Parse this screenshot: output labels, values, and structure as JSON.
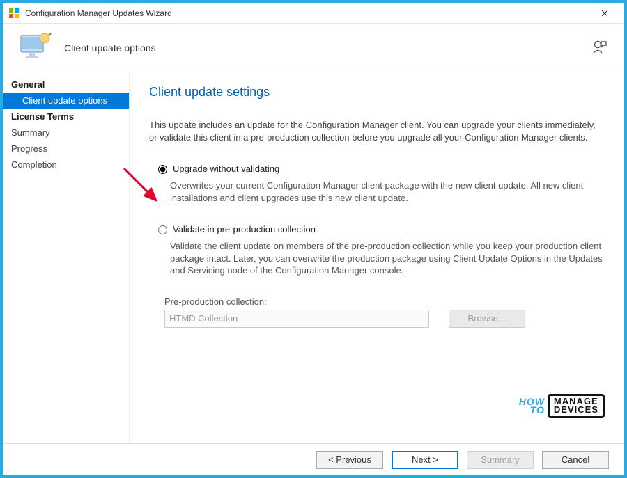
{
  "window": {
    "title": "Configuration Manager Updates Wizard"
  },
  "header": {
    "title": "Client update options"
  },
  "sidebar": {
    "items": [
      {
        "label": "General",
        "style": "bold"
      },
      {
        "label": "Client update options",
        "style": "selected indent"
      },
      {
        "label": "License Terms",
        "style": "bold"
      },
      {
        "label": "Summary",
        "style": ""
      },
      {
        "label": "Progress",
        "style": ""
      },
      {
        "label": "Completion",
        "style": ""
      }
    ]
  },
  "content": {
    "heading": "Client update settings",
    "intro": "This update includes an update for the Configuration Manager client. You can upgrade your clients immediately, or validate this client in a pre-production collection before you upgrade all your Configuration Manager clients.",
    "option1_label": "Upgrade without validating",
    "option1_desc": "Overwrites your current Configuration Manager client package with the new client update. All new client installations and client upgrades use this new client update.",
    "option2_label": "Validate in pre-production collection",
    "option2_desc": "Validate the client update on members of the pre-production collection while you keep your production client package intact. Later, you can overwrite the production package using Client Update Options in the Updates and Servicing node of the Configuration Manager console.",
    "collection_field_label": "Pre-production collection:",
    "collection_value": "HTMD Collection",
    "browse_label": "Browse..."
  },
  "footer": {
    "previous": "< Previous",
    "next": "Next >",
    "summary": "Summary",
    "cancel": "Cancel"
  },
  "watermark": {
    "how": "HOW",
    "to": "TO",
    "manage": "MANAGE",
    "devices": "DEVICES"
  }
}
